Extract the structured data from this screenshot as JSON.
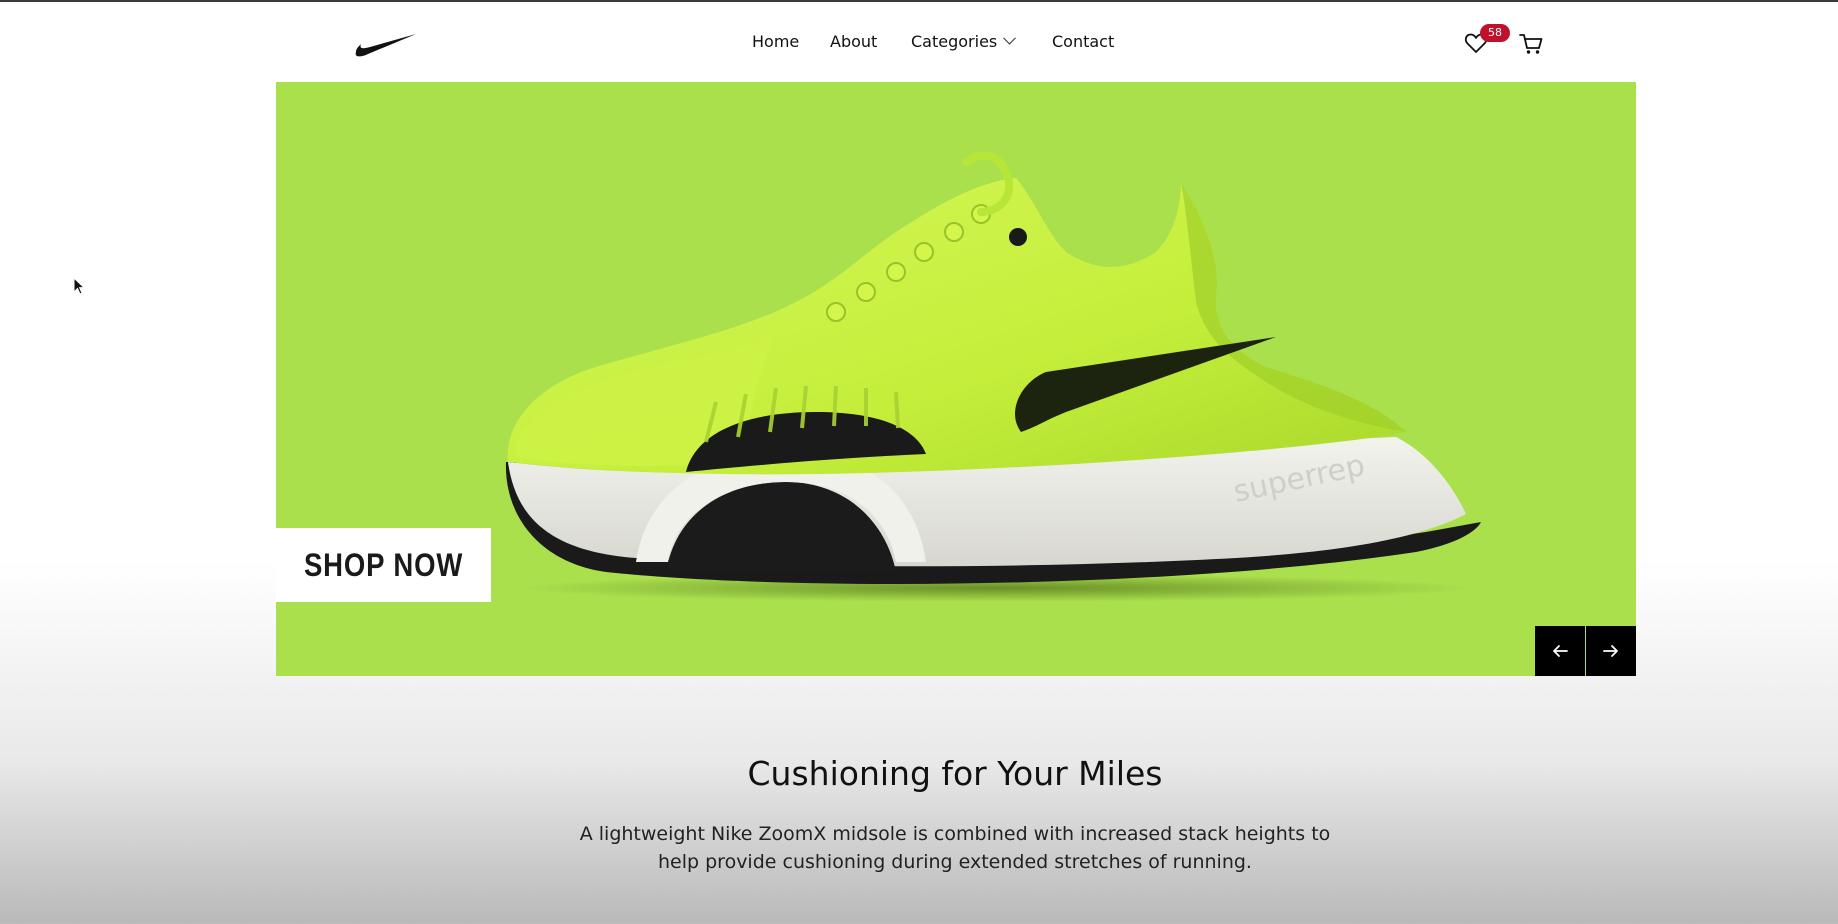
{
  "nav": {
    "items": [
      {
        "label": "Home"
      },
      {
        "label": "About"
      },
      {
        "label": "Categories"
      },
      {
        "label": "Contact"
      }
    ]
  },
  "header": {
    "logo_icon": "swoosh-logo-icon",
    "wishlist_icon": "heart-icon",
    "wishlist_count": "58",
    "cart_icon": "cart-icon"
  },
  "hero": {
    "cta_label": "SHOP NOW",
    "background_color": "#abe04d",
    "shoe_side_text": "superrep",
    "prev_icon": "arrow-left-icon",
    "next_icon": "arrow-right-icon"
  },
  "section": {
    "title": "Cushioning for Your Miles",
    "text_line1": "A lightweight Nike ZoomX midsole is combined with increased stack heights to",
    "text_line2": "help provide cushioning during extended stretches of running."
  },
  "colors": {
    "accent_badge": "#c0112b",
    "hero_green": "#abe04d",
    "shoe_volt": "#c8f23c"
  }
}
